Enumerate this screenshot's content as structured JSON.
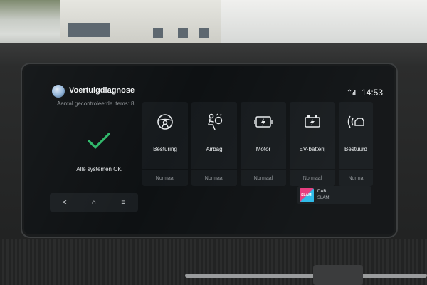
{
  "header": {
    "title": "Voertuigdiagnose",
    "subtitle": "Aantal gecontroleerde items: 8"
  },
  "status_bar": {
    "time": "14:53",
    "connectivity_icon": "phone-signal-icon"
  },
  "overall": {
    "icon": "checkmark-icon",
    "check_color": "#2fb86a",
    "text": "Alle systemen OK"
  },
  "nav": {
    "back": "<",
    "home": "⌂",
    "menu": "≡"
  },
  "items": [
    {
      "label": "Besturing",
      "status": "Normaal",
      "icon": "steering-wheel-icon"
    },
    {
      "label": "Airbag",
      "status": "Normaal",
      "icon": "airbag-icon"
    },
    {
      "label": "Motor",
      "status": "Normaal",
      "icon": "engine-icon"
    },
    {
      "label": "EV-batterij",
      "status": "Normaal",
      "icon": "ev-battery-icon"
    },
    {
      "label": "Bestuurd",
      "status": "Norma",
      "icon": "driver-assist-icon"
    }
  ],
  "media": {
    "logo": "SLAM!",
    "source": "DAB",
    "station": "SLAM!"
  }
}
